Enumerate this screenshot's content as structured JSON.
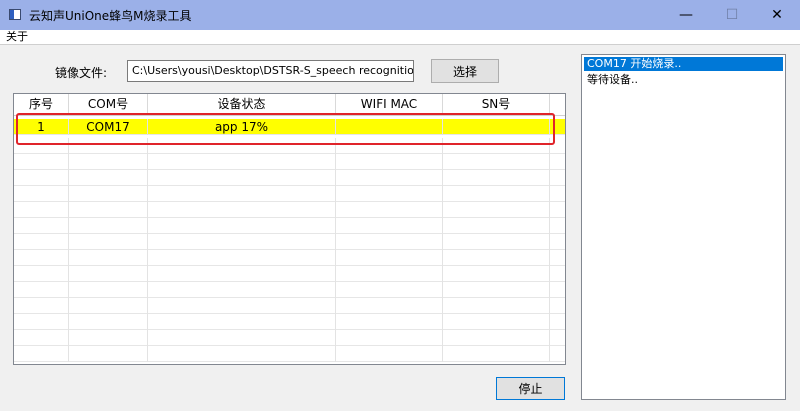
{
  "window": {
    "title": "云知声UniOne蜂鸟M烧录工具",
    "minimize_glyph": "—",
    "maximize_glyph": "☐",
    "close_glyph": "✕"
  },
  "menu": {
    "about": "关于"
  },
  "file": {
    "label": "镜像文件:",
    "path": "C:\\Users\\yousi\\Desktop\\DSTSR-S_speech recognition_",
    "choose_button": "选择"
  },
  "table": {
    "columns": [
      "序号",
      "COM号",
      "设备状态",
      "WIFI MAC",
      "SN号"
    ],
    "rows": [
      {
        "index": "1",
        "com": "COM17",
        "status": "app 17%",
        "mac": "",
        "sn": "",
        "selected": true
      }
    ],
    "empty_row_count": 14
  },
  "stop_button": "停止",
  "log": [
    {
      "text": "COM17 开始烧录..",
      "selected": true
    },
    {
      "text": "等待设备..",
      "selected": false
    }
  ],
  "colors": {
    "title_bar": "#9bb0e8",
    "selected_row": "#ffff00",
    "highlight_frame": "#e0242a",
    "log_selection": "#0078d7"
  }
}
